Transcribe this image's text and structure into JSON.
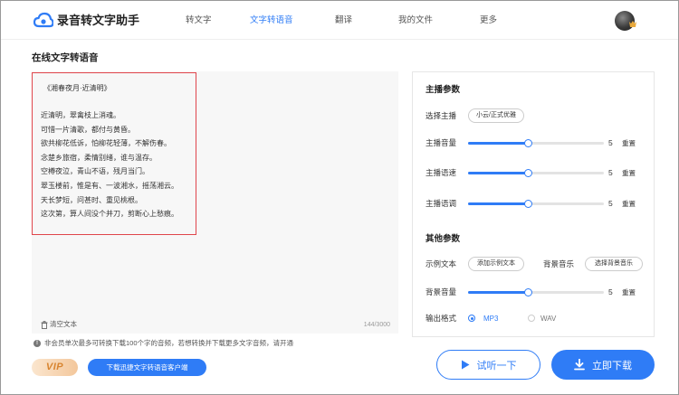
{
  "app": {
    "brand": "录音转文字助手",
    "accent_color": "#2f7cf6",
    "highlight_border_color": "#e0454b"
  },
  "nav": {
    "items": [
      {
        "label": "转文字",
        "active": false
      },
      {
        "label": "文字转语音",
        "active": true
      },
      {
        "label": "翻译",
        "active": false
      },
      {
        "label": "我的文件",
        "active": false
      },
      {
        "label": "更多",
        "active": false
      }
    ]
  },
  "page": {
    "title": "在线文字转语音"
  },
  "editor": {
    "poem_title": "《湘春夜月·近清明》",
    "lines": [
      "近清明，翠禽枝上消魂。",
      "可惜一片清歌，都付与黄昏。",
      "欲共柳花低诉，怕柳花轻薄，不解伤春。",
      "念楚乡旅宿，柔情别绪，谁与温存。",
      "空樽夜泣，青山不语，残月当门。",
      "翠玉楼前，惟是有、一波湘水，摇荡湘云。",
      "天长梦短，问甚时、重见桃根。",
      "这次第，算人间没个并刀，剪断心上愁痕。"
    ],
    "clear_label": "清空文本",
    "char_count": "144/3000"
  },
  "panel": {
    "anchor_section_title": "主播参数",
    "select_anchor_label": "选择主播",
    "anchor_value": "小云/正式优雅",
    "volume": {
      "label": "主播音量",
      "value": "5",
      "fraction": 0.44,
      "reset": "重置"
    },
    "speed": {
      "label": "主播语速",
      "value": "5",
      "fraction": 0.44,
      "reset": "重置"
    },
    "pitch": {
      "label": "主播语调",
      "value": "5",
      "fraction": 0.44,
      "reset": "重置"
    },
    "other_section_title": "其他参数",
    "sample_text_label": "示例文本",
    "sample_text_button": "添加示例文本",
    "bg_music_label": "背景音乐",
    "bg_music_button": "选择背景音乐",
    "bg_volume": {
      "label": "背景音量",
      "value": "5",
      "fraction": 0.44,
      "reset": "重置"
    },
    "output_format_label": "输出格式",
    "formats": [
      {
        "label": "MP3",
        "selected": true
      },
      {
        "label": "WAV",
        "selected": false
      }
    ]
  },
  "notice": {
    "text": "非会员单次最多可转换下载100个字的音频，若想转换并下载更多文字音频，请开通"
  },
  "bottom": {
    "vip_label": "VIP",
    "download_client_label": "下载迅捷文字转语音客户端",
    "listen_label": "试听一下",
    "download_label": "立即下载"
  }
}
